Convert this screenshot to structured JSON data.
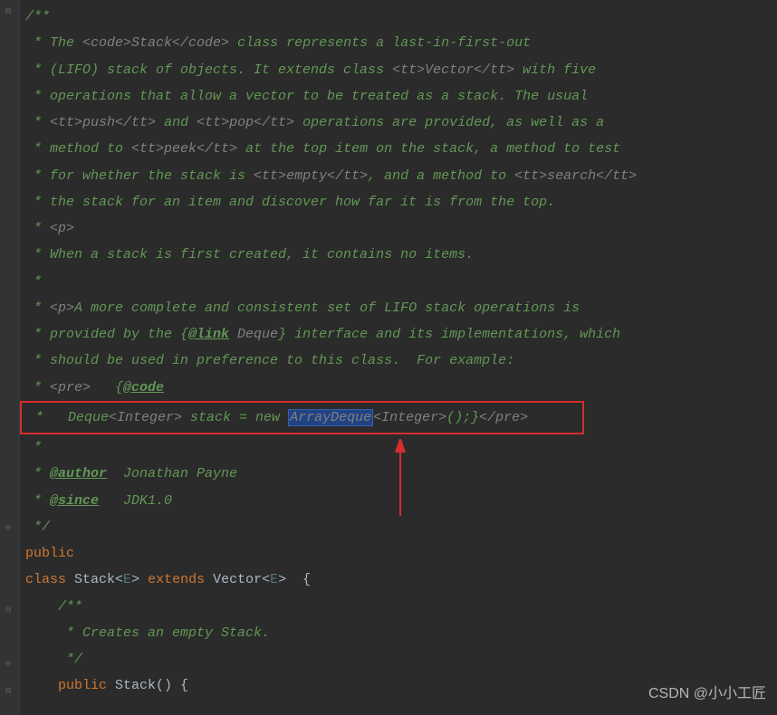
{
  "javadoc": {
    "open": "/**",
    "l1a": " * The ",
    "l1b": "<code>",
    "l1c": "Stack",
    "l1d": "</code>",
    "l1e": " class represents a last-in-first-out",
    "l2a": " * (LIFO) stack of objects. It extends class ",
    "l2b": "<tt>",
    "l2c": "Vector",
    "l2d": "</tt>",
    "l2e": " with five",
    "l3": " * operations that allow a vector to be treated as a stack. The usual",
    "l4a": " * ",
    "l4b": "<tt>",
    "l4c": "push",
    "l4d": "</tt>",
    "l4e": " and ",
    "l4f": "<tt>",
    "l4g": "pop",
    "l4h": "</tt>",
    "l4i": " operations are provided, as well as a",
    "l5a": " * method to ",
    "l5b": "<tt>",
    "l5c": "peek",
    "l5d": "</tt>",
    "l5e": " at the top item on the stack, a method to test",
    "l6a": " * for whether the stack is ",
    "l6b": "<tt>",
    "l6c": "empty",
    "l6d": "</tt>",
    "l6e": ", and a method to ",
    "l6f": "<tt>",
    "l6g": "search",
    "l6h": "</tt>",
    "l7": " * the stack for an item and discover how far it is from the top.",
    "l8a": " * ",
    "l8b": "<p>",
    "l9": " * When a stack is first created, it contains no items.",
    "l10": " *",
    "l11a": " * ",
    "l11b": "<p>",
    "l11c": "A more complete and consistent set of LIFO stack operations is",
    "l12a": " * provided by the {",
    "l12b": "@link",
    "l12c": " Deque",
    "l12d": "} interface and its implementations, which",
    "l13": " * should be used in preference to this class.  For example:",
    "l14a": " * ",
    "l14b": "<pre>",
    "l14c": "   {",
    "l14d": "@code",
    "l15a": " *   Deque",
    "l15b": "<Integer>",
    "l15c": " stack = new ",
    "l15d": "ArrayDeque",
    "l15e": "<Integer>",
    "l15f": "();}",
    "l15g": "</pre>",
    "l16": " *",
    "l17a": " * ",
    "l17b": "@author",
    "l17c": "  Jonathan Payne",
    "l18a": " * ",
    "l18b": "@since",
    "l18c": "   JDK1.0",
    "close": " */"
  },
  "code": {
    "public": "public",
    "class": "class ",
    "stack": "Stack",
    "lt": "<",
    "e": "E",
    "gt": "> ",
    "extends": "extends ",
    "vector": "Vector",
    "brace": " {",
    "inner_open": "    /**",
    "inner_l1": "     * Creates an empty Stack.",
    "inner_close": "     */",
    "ctor_public": "    public ",
    "ctor_stack": "Stack",
    "ctor_parens": "() {"
  },
  "watermark": "CSDN @小小工匠"
}
